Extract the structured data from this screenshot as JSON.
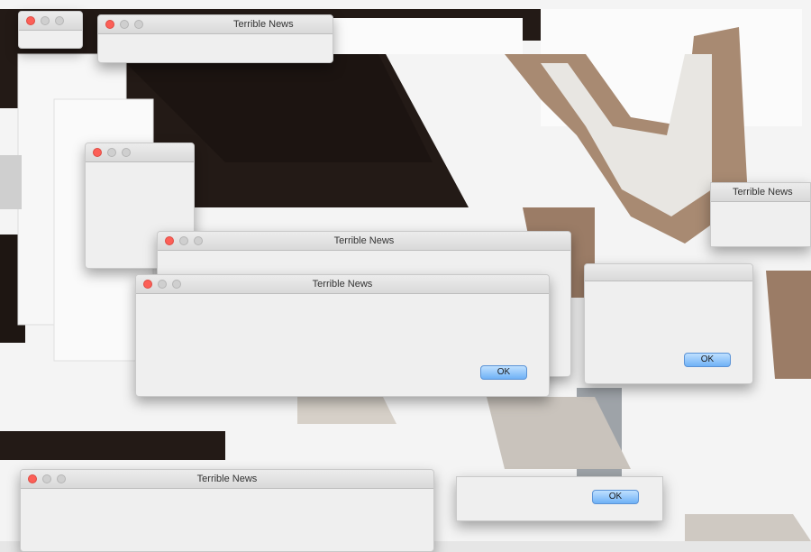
{
  "dialog": {
    "title": "Terrible News",
    "ok_label": "OK"
  },
  "colors": {
    "close": "#fc5f57",
    "window_bg": "#efefef",
    "ok_top": "#bfe0ff",
    "ok_bottom": "#6fb1f6"
  }
}
